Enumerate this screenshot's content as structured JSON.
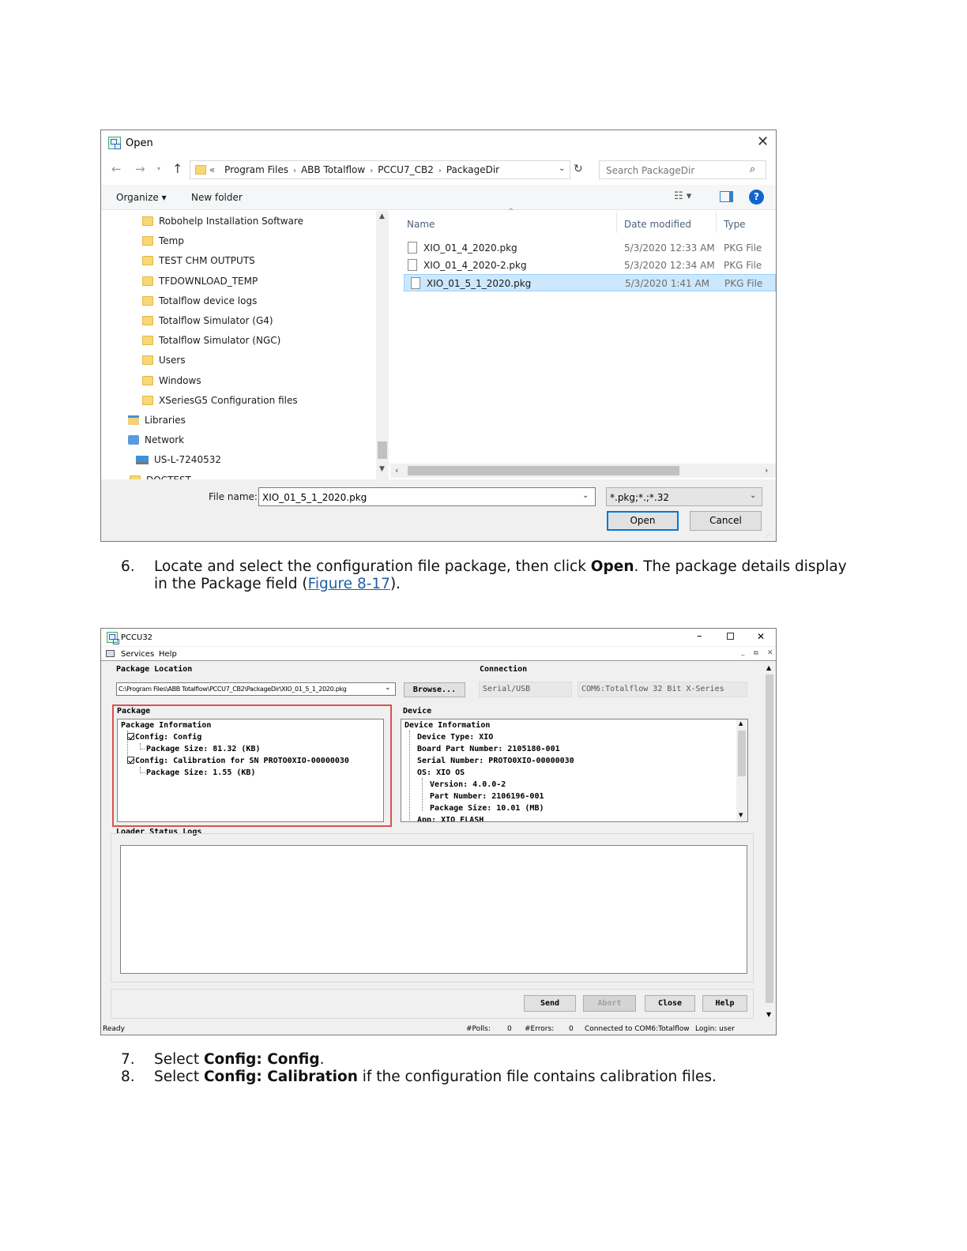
{
  "open_dialog": {
    "title": "Open",
    "breadcrumb": [
      "«",
      "Program Files",
      "ABB Totalflow",
      "PCCU7_CB2",
      "PackageDir"
    ],
    "search_placeholder": "Search PackageDir",
    "toolbar": {
      "organize": "Organize ▾",
      "new_folder": "New folder"
    },
    "nav_items": [
      {
        "label": "Robohelp Installation Software",
        "kind": "folder"
      },
      {
        "label": "Temp",
        "kind": "folder"
      },
      {
        "label": "TEST CHM OUTPUTS",
        "kind": "folder"
      },
      {
        "label": "TFDOWNLOAD_TEMP",
        "kind": "folder"
      },
      {
        "label": "Totalflow device logs",
        "kind": "folder"
      },
      {
        "label": "Totalflow Simulator (G4)",
        "kind": "folder"
      },
      {
        "label": "Totalflow Simulator (NGC)",
        "kind": "folder"
      },
      {
        "label": "Users",
        "kind": "folder"
      },
      {
        "label": "Windows",
        "kind": "folder"
      },
      {
        "label": "XSeriesG5 Configuration files",
        "kind": "folder"
      },
      {
        "label": "Libraries",
        "kind": "libraries"
      },
      {
        "label": "Network",
        "kind": "network"
      },
      {
        "label": "US-L-7240532",
        "kind": "computer"
      },
      {
        "label": "DOCTEST",
        "kind": "folder"
      }
    ],
    "columns": {
      "name": "Name",
      "date": "Date modified",
      "type": "Type"
    },
    "files": [
      {
        "name": "XIO_01_4_2020.pkg",
        "date": "5/3/2020 12:33 AM",
        "type": "PKG File",
        "selected": false
      },
      {
        "name": "XIO_01_4_2020-2.pkg",
        "date": "5/3/2020 12:34 AM",
        "type": "PKG File",
        "selected": false
      },
      {
        "name": "XIO_01_5_1_2020.pkg",
        "date": "5/3/2020 1:41 AM",
        "type": "PKG File",
        "selected": true
      }
    ],
    "file_name_label": "File name:",
    "file_name_value": "XIO_01_5_1_2020.pkg",
    "file_type_value": "*.pkg;*.;*.32",
    "open_button": "Open",
    "cancel_button": "Cancel"
  },
  "step6": {
    "num": "6.",
    "text_before": "Locate and select the configuration file package, then click ",
    "bold": "Open",
    "text_mid": ". The package details display in the Package field (",
    "link": "Figure 8-17",
    "text_after": ")."
  },
  "pccu": {
    "title": "PCCU32",
    "menu": [
      "Services",
      "Help"
    ],
    "package_location_label": "Package Location",
    "package_path": "C:\\Program Files\\ABB Totalflow\\PCCU7_CB2\\PackageDir\\XIO_01_5_1_2020.pkg",
    "browse_button": "Browse...",
    "connection_label": "Connection",
    "connection_type": "Serial/USB",
    "connection_target": "COM6:Totalflow 32 Bit X-Series",
    "package_label": "Package",
    "package_tree": {
      "root": "Package Information",
      "config1": "Config: Config",
      "config1_size": "Package Size: 81.32 (KB)",
      "config2": "Config: Calibration for SN PROTO0XIO-00000030",
      "config2_size": "Package Size: 1.55 (KB)"
    },
    "device_label": "Device",
    "device_tree": {
      "root": "Device Information",
      "type": "Device Type: XIO",
      "board": "Board Part Number: 2105180-001",
      "serial": "Serial Number: PROTO0XIO-00000030",
      "os": "OS: XIO OS",
      "version": "Version: 4.0.0-2",
      "part": "Part Number: 2106196-001",
      "size": "Package Size: 10.01 (MB)",
      "app": "App: XIO FLASH"
    },
    "loader_label": "Loader Status Logs",
    "buttons": {
      "send": "Send",
      "abort": "Abort",
      "close": "Close",
      "help": "Help"
    },
    "status": {
      "ready": "Ready",
      "polls_label": "#Polls:",
      "polls": "0",
      "errors_label": "#Errors:",
      "errors": "0",
      "connected": "Connected to COM6:Totalflow",
      "login": "Login: user"
    }
  },
  "step7": {
    "num": "7.",
    "before": "Select ",
    "bold": "Config: Config",
    "after": "."
  },
  "step8": {
    "num": "8.",
    "before": "Select ",
    "bold": "Config: Calibration",
    "after": " if the configuration file contains calibration files."
  }
}
